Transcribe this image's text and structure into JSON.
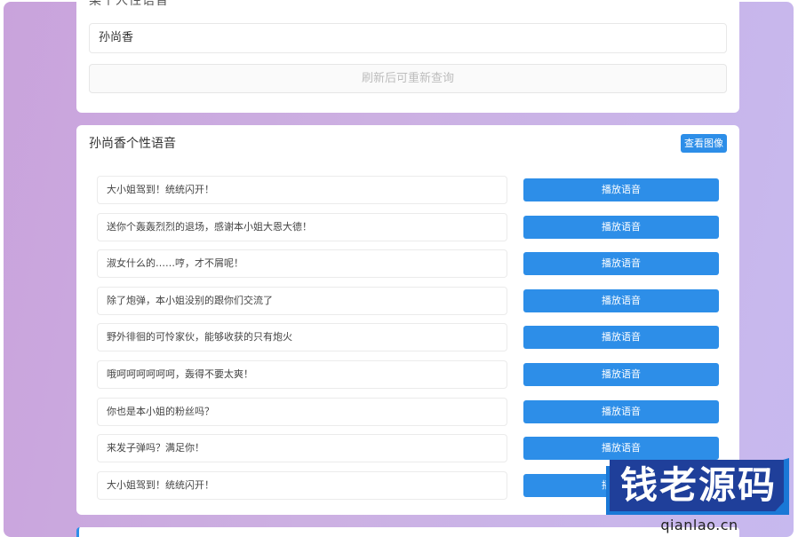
{
  "top_card": {
    "heading_partial": "某个人性语音",
    "name_value": "孙尚香",
    "refresh_label": "刷新后可重新查询"
  },
  "voice_card": {
    "title": "孙尚香个性语音",
    "view_image_label": "查看图像",
    "play_label": "播放语音",
    "rows": [
      {
        "text": "大小姐驾到！统统闪开！"
      },
      {
        "text": "送你个轰轰烈烈的退场，感谢本小姐大恩大德！"
      },
      {
        "text": "淑女什么的……哼，才不屑呢！"
      },
      {
        "text": "除了炮弹，本小姐没别的跟你们交流了"
      },
      {
        "text": "野外徘徊的可怜家伙，能够收获的只有炮火"
      },
      {
        "text": "哦呵呵呵呵呵呵，轰得不要太爽！"
      },
      {
        "text": "你也是本小姐的粉丝吗？"
      },
      {
        "text": "来发子弹吗？满足你！"
      },
      {
        "text": "大小姐驾到！统统闪开！"
      }
    ]
  },
  "watermark": {
    "text": "钱老源码",
    "url": "qianlao.cn"
  }
}
